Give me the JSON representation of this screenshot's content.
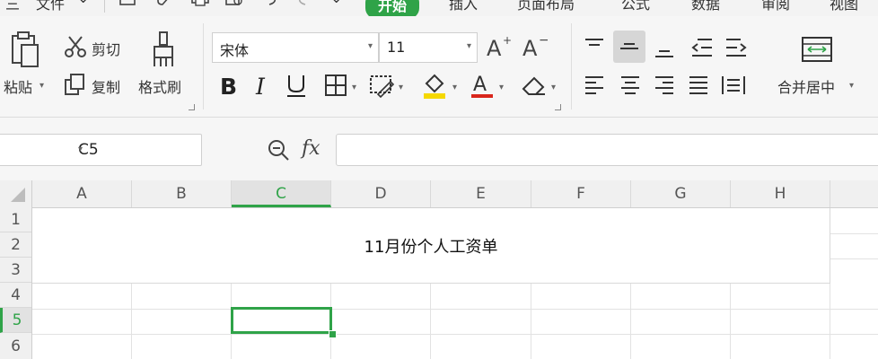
{
  "menubar": {
    "items": [
      "三",
      "文件",
      "开始",
      "插入",
      "页面布局",
      "公式",
      "数据",
      "审阅",
      "视图"
    ],
    "file_label": "文件",
    "active_label": "开始",
    "insert_label": "插入",
    "layout_label": "页面布局",
    "formula_label": "公式",
    "data_label": "数据",
    "review_label": "审阅",
    "view_label": "视图",
    "hamburger": "三"
  },
  "ribbon": {
    "paste_label": "粘贴",
    "cut_label": "剪切",
    "copy_label": "复制",
    "format_painter_label": "格式刷",
    "font_name": "宋体",
    "font_size": "11",
    "merge_center_label": "合并居中",
    "accent_color": "#2fa348",
    "font_color_bar": "#d9261c",
    "fill_color_bar": "#f5d800"
  },
  "formula_bar": {
    "name_box": "C5",
    "fx_label": "fx",
    "formula_value": ""
  },
  "sheet": {
    "columns": [
      "A",
      "B",
      "C",
      "D",
      "E",
      "F",
      "G",
      "H"
    ],
    "rows": [
      "1",
      "2",
      "3",
      "4",
      "5",
      "6"
    ],
    "selected_column": "C",
    "selected_row": "5",
    "title_cell_text": "11月份个人工资单"
  }
}
